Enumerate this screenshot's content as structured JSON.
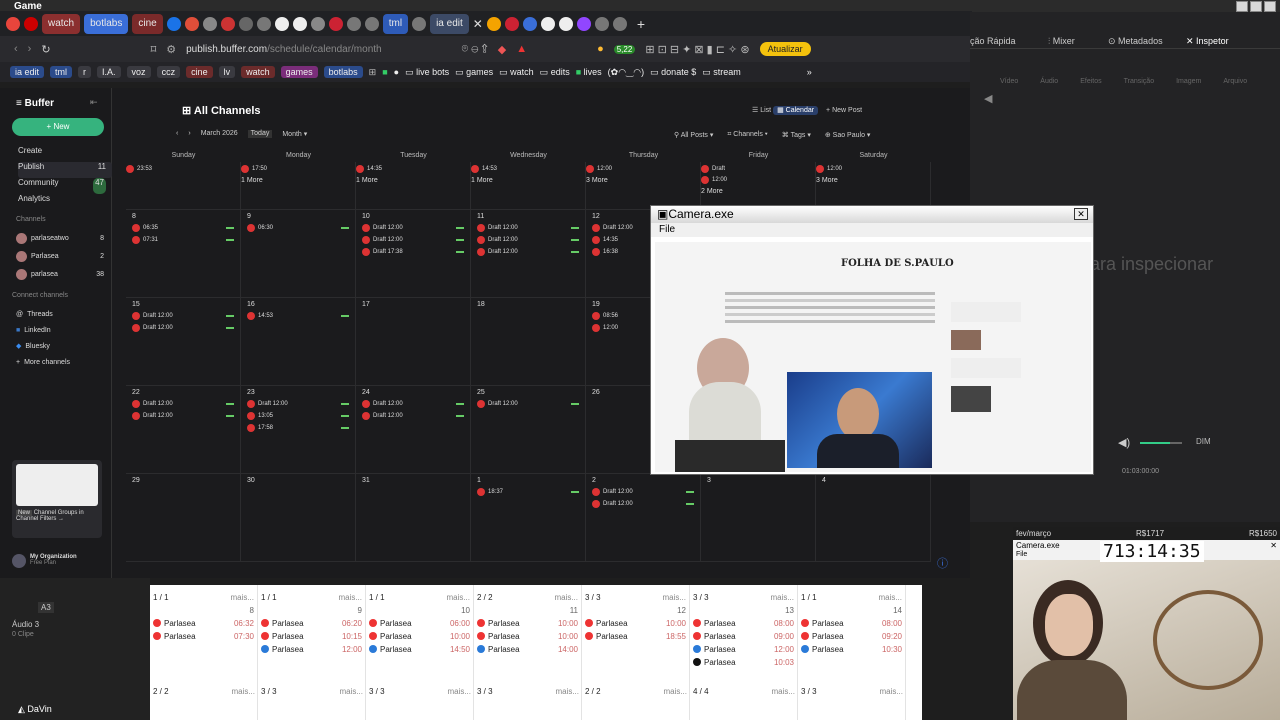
{
  "window": {
    "app_title": "Game"
  },
  "tabs": {
    "items": [
      {
        "label": "watch",
        "color": "#a83232"
      },
      {
        "label": "botlabs",
        "color": "#3a6ed8"
      },
      {
        "label": "cine",
        "color": "#8b2f2f"
      },
      {
        "label": "tml",
        "color": "#2e5bb8"
      },
      {
        "label": "ia edit",
        "color": "#2e5bb8"
      }
    ]
  },
  "browser": {
    "url_host": "publish.buffer.com",
    "url_path": "/schedule/calendar/month",
    "update_label": "Atualizar",
    "badge_count": "5,22"
  },
  "bookmarks": {
    "chips": [
      "ia edit",
      "tml",
      "r",
      "I.A.",
      "voz",
      "ccz",
      "cine",
      "lv",
      "watch",
      "games",
      "botlabs"
    ],
    "folders": [
      "live bots",
      "games",
      "watch",
      "edits",
      "lives",
      "(✿◠‿◠)",
      "donate $",
      "stream"
    ]
  },
  "sidebar": {
    "logo": "Buffer",
    "new_label": "New",
    "nav": [
      {
        "label": "Create",
        "count": ""
      },
      {
        "label": "Publish",
        "count": "11"
      },
      {
        "label": "Community",
        "count": "47"
      },
      {
        "label": "Analytics",
        "count": ""
      }
    ],
    "channels_label": "Channels",
    "channels": [
      {
        "name": "parlaseatwo",
        "count": "8"
      },
      {
        "name": "Parlasea",
        "count": "2"
      },
      {
        "name": "parlasea",
        "count": "38"
      }
    ],
    "connect_label": "Connect channels",
    "connect": [
      "Threads",
      "LinkedIn",
      "Bluesky",
      "More channels"
    ],
    "promo_new": "New",
    "promo_text": "Channel Groups in Channel Filters →",
    "org_name": "My Organization",
    "org_plan": "Free Plan"
  },
  "calendar": {
    "title": "All Channels",
    "month": "March 2026",
    "today": "Today",
    "view": "Month",
    "list_label": "List",
    "calendar_label": "Calendar",
    "newpost_label": "New Post",
    "filters": [
      "All Posts",
      "Channels",
      "Tags",
      "Sao Paulo"
    ],
    "days": [
      "Sunday",
      "Monday",
      "Tuesday",
      "Wednesday",
      "Thursday",
      "Friday",
      "Saturday"
    ],
    "week0": [
      {
        "posts": [
          "23:53"
        ],
        "more": ""
      },
      {
        "posts": [
          "17:50"
        ],
        "more": "1 More"
      },
      {
        "posts": [
          "14:35"
        ],
        "more": "1 More"
      },
      {
        "posts": [
          "14:53"
        ],
        "more": "1 More"
      },
      {
        "posts": [
          "12:00"
        ],
        "more": "3 More"
      },
      {
        "posts": [
          "Draft",
          "12:00"
        ],
        "more": "2 More"
      },
      {
        "posts": [
          "12:00"
        ],
        "more": "3 More"
      }
    ],
    "weeks": [
      {
        "nums": [
          "8",
          "9",
          "10",
          "11",
          "12",
          "13",
          "14"
        ],
        "cells": [
          [
            "06:35",
            "07:31"
          ],
          [
            "06:30"
          ],
          [
            "Draft 12:00",
            "Draft 12:00",
            "Draft 17:38"
          ],
          [
            "Draft 12:00",
            "Draft 12:00",
            "Draft 12:00"
          ],
          [
            "Draft 12:00",
            "14:35",
            "16:38"
          ],
          [],
          []
        ]
      },
      {
        "nums": [
          "15",
          "16",
          "17",
          "18",
          "19",
          "20",
          "21"
        ],
        "cells": [
          [
            "Draft 12:00",
            "Draft 12:00"
          ],
          [
            "14:53"
          ],
          [],
          [],
          [
            "08:56",
            "12:00"
          ],
          [],
          []
        ]
      },
      {
        "nums": [
          "22",
          "23",
          "24",
          "25",
          "26",
          "27",
          "28"
        ],
        "cells": [
          [
            "Draft 12:00",
            "Draft 12:00"
          ],
          [
            "Draft 12:00",
            "13:05",
            "17:58"
          ],
          [
            "Draft 12:00",
            "Draft 12:00"
          ],
          [
            "Draft 12:00"
          ],
          [],
          [],
          []
        ]
      },
      {
        "nums": [
          "29",
          "30",
          "31",
          "1",
          "2",
          "3",
          "4"
        ],
        "cells": [
          [],
          [],
          [],
          [
            "18:37"
          ],
          [
            "Draft 12:00",
            "Draft 12:00"
          ],
          [],
          []
        ]
      }
    ]
  },
  "camera": {
    "title": "Camera.exe",
    "menu": "File",
    "news_brand": "FOLHA DE S.PAULO"
  },
  "resolve": {
    "tools": [
      "Mixer",
      "Metadados",
      "Inspetor"
    ],
    "edit_label": "ção Rápida",
    "placeholder": "ara inspecionar",
    "tabs": [
      "Vídeo",
      "Áudio",
      "Efeitos",
      "Transição",
      "Imagem",
      "Arquivo"
    ],
    "dim": "DIM",
    "timecode": "01:03:00:00",
    "audio_track": "Áudio 3",
    "clips": "0 Clipe",
    "a3": "A3",
    "app": "DaVin"
  },
  "bottomcal": {
    "cols": [
      {
        "head": "1 / 1",
        "num": "8",
        "rows": [
          [
            "Parlasea",
            "06:32"
          ],
          [
            "Parlasea",
            "07:30"
          ]
        ],
        "foot": "2 / 2"
      },
      {
        "head": "1 / 1",
        "num": "9",
        "rows": [
          [
            "Parlasea",
            "06:20"
          ],
          [
            "Parlasea",
            "10:15"
          ],
          [
            "Parlasea",
            "12:00"
          ]
        ],
        "foot": "3 / 3"
      },
      {
        "head": "1 / 1",
        "num": "10",
        "rows": [
          [
            "Parlasea",
            "06:00"
          ],
          [
            "Parlasea",
            "10:00"
          ],
          [
            "Parlasea",
            "14:50"
          ]
        ],
        "foot": "3 / 3"
      },
      {
        "head": "2 / 2",
        "num": "11",
        "rows": [
          [
            "Parlasea",
            "10:00"
          ],
          [
            "Parlasea",
            "10:00"
          ],
          [
            "Parlasea",
            "14:00"
          ]
        ],
        "foot": "3 / 3"
      },
      {
        "head": "3 / 3",
        "num": "12",
        "rows": [
          [
            "Parlasea",
            "10:00"
          ],
          [
            "Parlasea",
            "18:55"
          ]
        ],
        "foot": "2 / 2"
      },
      {
        "head": "3 / 3",
        "num": "13",
        "rows": [
          [
            "Parlasea",
            "08:00"
          ],
          [
            "Parlasea",
            "09:00"
          ],
          [
            "Parlasea",
            "12:00"
          ],
          [
            "Parlasea",
            "10:03"
          ]
        ],
        "foot": "4 / 4"
      },
      {
        "head": "1 / 1",
        "num": "14",
        "rows": [
          [
            "Parlasea",
            "08:00"
          ],
          [
            "Parlasea",
            "09:20"
          ],
          [
            "Parlasea",
            "10:30"
          ]
        ],
        "foot": "3 / 3"
      }
    ],
    "more": "mais..."
  },
  "webcam": {
    "header_left": "fev/março",
    "header_right": "R$1717",
    "header_right2": "R$1650",
    "title": "Camera.exe",
    "menu": "File",
    "timer": "713:14:35"
  }
}
